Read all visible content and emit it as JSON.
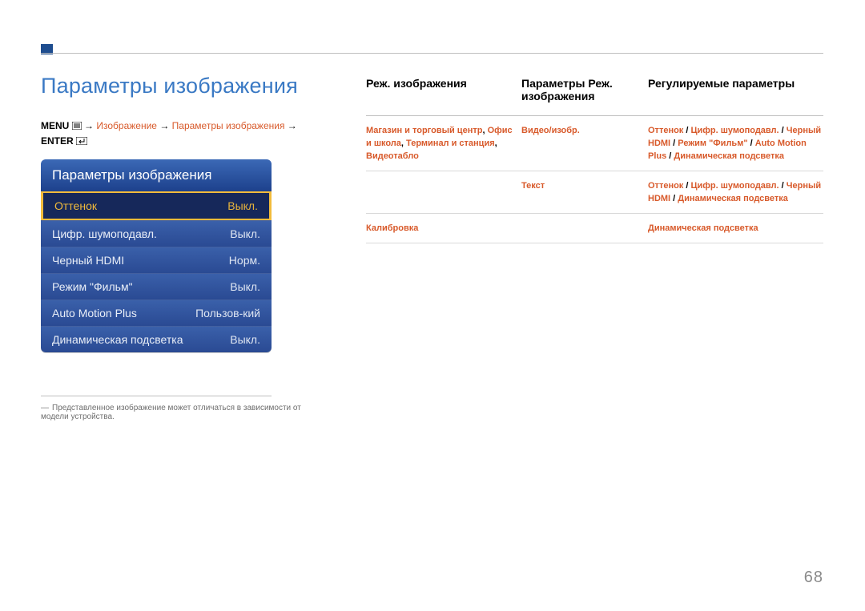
{
  "page": {
    "title": "Параметры изображения",
    "pageNumber": "68"
  },
  "breadcrumb": {
    "menu": "MENU",
    "arrow": " → ",
    "seg1": "Изображение",
    "seg2": "Параметры изображения",
    "enter": "ENTER"
  },
  "osd": {
    "header": "Параметры изображения",
    "rows": [
      {
        "label": "Оттенок",
        "value": "Выкл.",
        "selected": true
      },
      {
        "label": "Цифр. шумоподавл.",
        "value": "Выкл."
      },
      {
        "label": "Черный HDMI",
        "value": "Норм."
      },
      {
        "label": "Режим \"Фильм\"",
        "value": "Выкл."
      },
      {
        "label": "Auto Motion Plus",
        "value": "Пользов-кий"
      },
      {
        "label": "Динамическая подсветка",
        "value": "Выкл."
      }
    ]
  },
  "footnote": "Представленное изображение может отличаться в зависимости от модели устройства.",
  "table": {
    "headers": {
      "c1": "Реж. изображения",
      "c2": "Параметры Реж. изображения",
      "c3": "Регулируемые параметры"
    },
    "rows": [
      {
        "c1": "<span class='hl'>Магазин и торговый центр</span><span class='nk'>, </span><span class='hl'>Офис и школа</span><span class='nk'>, </span><span class='hl'>Терминал и станция</span><span class='nk'>, </span><span class='hl'>Видеотабло</span>",
        "c2": "<span class='hl'>Видео/изобр.</span>",
        "c3": "<span class='hl'>Оттенок</span><span class='nk'> / </span><span class='hl'>Цифр. шумоподавл.</span><span class='nk'> / </span><span class='hl'>Черный HDMI</span><span class='nk'> / </span><span class='hl'>Режим \"Фильм\"</span><span class='nk'> / </span><span class='hl'>Auto Motion Plus</span><span class='nk'> / </span><span class='hl'>Динамическая подсветка</span>"
      },
      {
        "c1": "",
        "c2": "<span class='hl'>Текст</span>",
        "c3": "<span class='hl'>Оттенок</span><span class='nk'> / </span><span class='hl'>Цифр. шумоподавл.</span><span class='nk'> / </span><span class='hl'>Черный HDMI</span><span class='nk'> / </span><span class='hl'>Динамическая подсветка</span>"
      },
      {
        "c1": "<span class='hl'>Калибровка</span>",
        "c2": "",
        "c3": "<span class='hl'>Динамическая подсветка</span>"
      }
    ]
  }
}
